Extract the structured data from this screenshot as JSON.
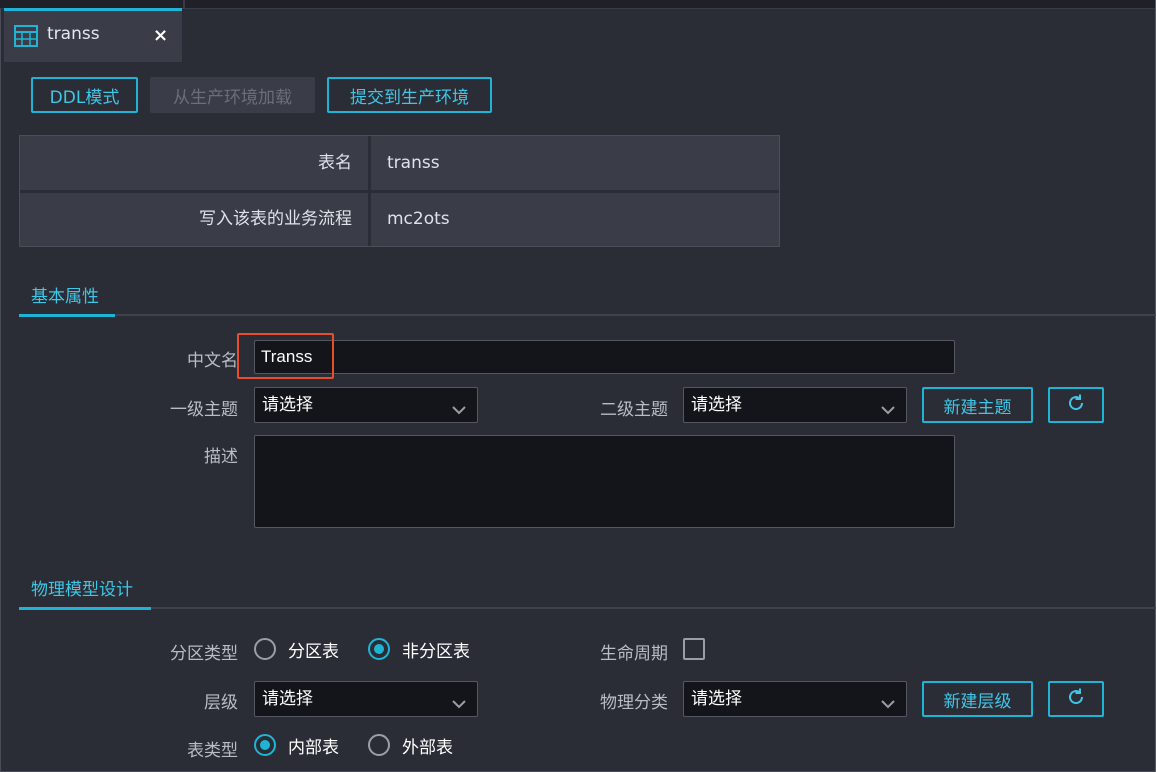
{
  "tab": {
    "title": "transs",
    "icon": "table-icon",
    "close_icon": "close-icon",
    "close_label": "×"
  },
  "toolbar": {
    "ddl_label": "DDL模式",
    "load_label": "从生产环境加载",
    "submit_label": "提交到生产环境"
  },
  "info": {
    "rows": [
      {
        "label": "表名",
        "value": "transs"
      },
      {
        "label": "写入该表的业务流程",
        "value": "mc2ots"
      }
    ]
  },
  "basic": {
    "section_title": "基本属性",
    "cn_name_label": "中文名",
    "cn_name_value": "Transs",
    "topic1_label": "一级主题",
    "topic1_value": "请选择",
    "topic2_label": "二级主题",
    "topic2_value": "请选择",
    "new_topic_label": "新建主题",
    "refresh_icon": "refresh-icon",
    "desc_label": "描述",
    "desc_value": ""
  },
  "physical": {
    "section_title": "物理模型设计",
    "partition_label": "分区类型",
    "partition_options": [
      {
        "label": "分区表",
        "selected": false
      },
      {
        "label": "非分区表",
        "selected": true
      }
    ],
    "lifecycle_label": "生命周期",
    "lifecycle_checked": false,
    "level_label": "层级",
    "level_value": "请选择",
    "phys_class_label": "物理分类",
    "phys_class_value": "请选择",
    "new_level_label": "新建层级",
    "table_type_label": "表类型",
    "table_type_options": [
      {
        "label": "内部表",
        "selected": true
      },
      {
        "label": "外部表",
        "selected": false
      }
    ]
  },
  "colors": {
    "accent": "#1fb4d6",
    "background": "#2b2d36",
    "highlight_box": "#e5502a"
  }
}
